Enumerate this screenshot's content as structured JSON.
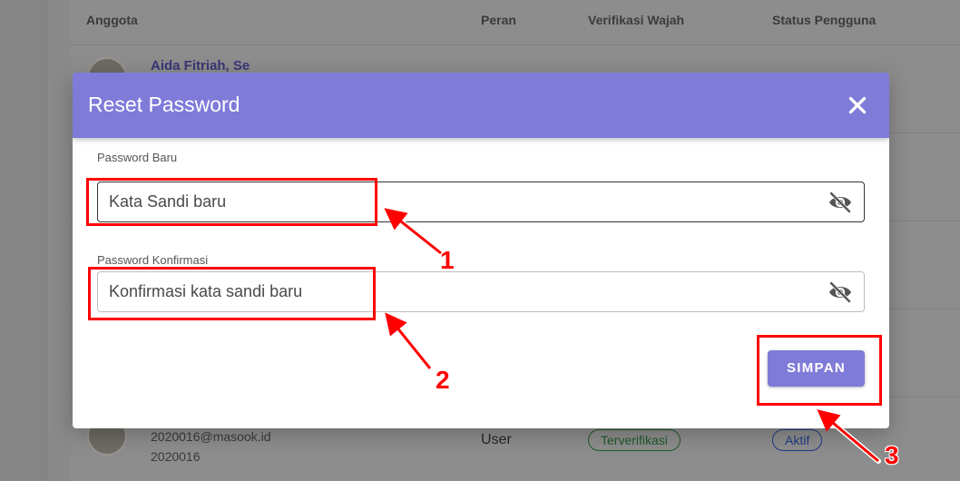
{
  "background_table": {
    "headers": [
      "Anggota",
      "Peran",
      "Verifikasi Wajah",
      "Status Pengguna"
    ],
    "first_row": {
      "name": "Aida Fitriah, Se"
    },
    "last_row": {
      "email": "2020016@masook.id",
      "member_id": "2020016",
      "role": "User",
      "face_verification": "Terverifikasi",
      "status": "Aktif"
    }
  },
  "modal": {
    "title": "Reset Password",
    "close_icon": "close-icon",
    "new_password": {
      "label": "Password Baru",
      "placeholder": "Kata Sandi baru",
      "value": "",
      "icon": "eye-off-icon"
    },
    "confirm_password": {
      "label": "Password Konfirmasi",
      "placeholder": "Konfirmasi kata sandi baru",
      "value": "",
      "icon": "eye-off-icon"
    },
    "save_label": "SIMPAN"
  },
  "annotations": {
    "numbers": [
      "1",
      "2",
      "3"
    ],
    "color": "#ff0000"
  },
  "colors": {
    "accent": "#7f7bd9",
    "overlay": "#8a8a8a"
  }
}
